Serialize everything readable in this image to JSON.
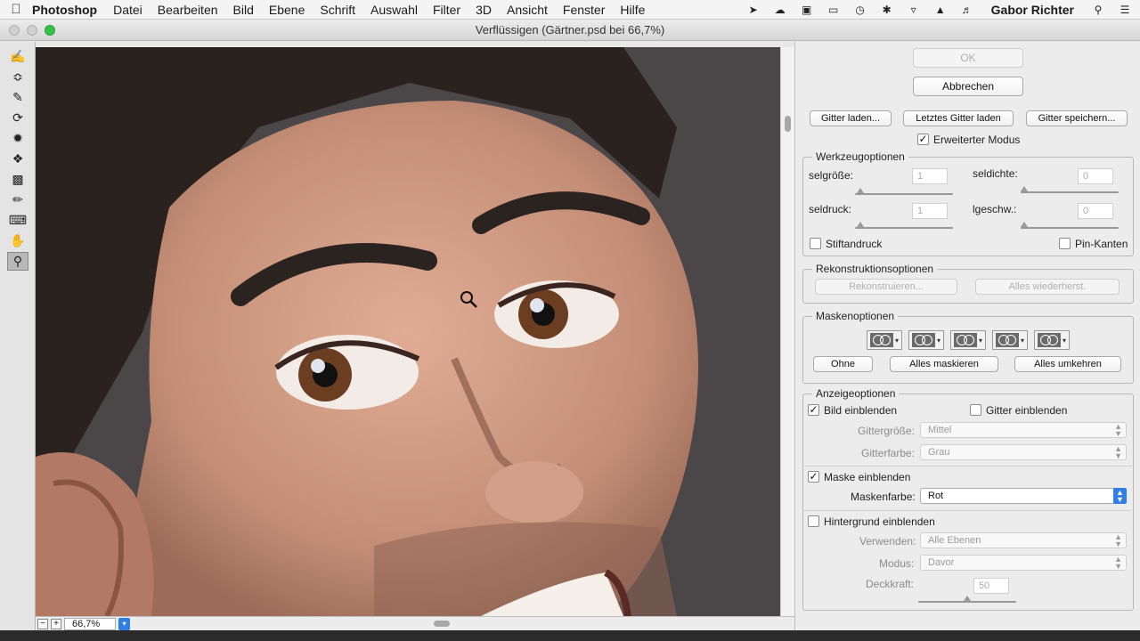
{
  "menubar": {
    "apple": "",
    "app": "Photoshop",
    "items": [
      "Datei",
      "Bearbeiten",
      "Bild",
      "Ebene",
      "Schrift",
      "Auswahl",
      "Filter",
      "3D",
      "Ansicht",
      "Fenster",
      "Hilfe"
    ],
    "user": "Gabor Richter",
    "tray_icons": [
      "forward-icon",
      "cloud-icon",
      "display-icon",
      "airplay-icon",
      "time-machine-icon",
      "bluetooth-icon",
      "wifi-icon",
      "eject-icon",
      "volume-icon",
      "search-icon",
      "list-icon"
    ]
  },
  "window": {
    "title": "Verflüssigen (Gärtner.psd bei 66,7%)"
  },
  "tools": [
    "forward-warp-icon",
    "reconstruct-icon",
    "smooth-icon",
    "twirl-icon",
    "pucker-icon",
    "bloat-icon",
    "push-left-icon",
    "freeze-mask-icon",
    "thaw-mask-icon",
    "hand-icon",
    "zoom-icon"
  ],
  "canvas": {
    "zoom": "66,7%"
  },
  "panel": {
    "ok": "OK",
    "cancel": "Abbrechen",
    "load_mesh": "Gitter laden...",
    "load_last_mesh": "Letztes Gitter laden",
    "save_mesh": "Gitter speichern...",
    "advanced_mode": "Erweiterter Modus",
    "tool_options": {
      "title": "Werkzeugoptionen",
      "brush_size_label": "selgröße:",
      "brush_size": "1",
      "brush_density_label": "seldichte:",
      "brush_density": "0",
      "brush_pressure_label": "seldruck:",
      "brush_pressure": "1",
      "brush_rate_label": "lgeschw.:",
      "brush_rate": "0",
      "stylus_pressure": "Stiftandruck",
      "pin_edges": "Pin-Kanten"
    },
    "reconstruct_options": {
      "title": "Rekonstruktionsoptionen",
      "reconstruct": "Rekonstruieren...",
      "restore_all": "Alles wiederherst."
    },
    "mask_options": {
      "title": "Maskenoptionen",
      "none": "Ohne",
      "mask_all": "Alles maskieren",
      "invert_all": "Alles umkehren"
    },
    "view_options": {
      "title": "Anzeigeoptionen",
      "show_image": "Bild einblenden",
      "show_mesh": "Gitter einblenden",
      "mesh_size_label": "Gittergröße:",
      "mesh_size": "Mittel",
      "mesh_color_label": "Gitterfarbe:",
      "mesh_color": "Grau",
      "show_mask": "Maske einblenden",
      "mask_color_label": "Maskenfarbe:",
      "mask_color": "Rot",
      "show_backdrop": "Hintergrund einblenden",
      "use_label": "Verwenden:",
      "use": "Alle Ebenen",
      "mode_label": "Modus:",
      "mode": "Davor",
      "opacity_label": "Deckkraft:",
      "opacity": "50"
    }
  },
  "colors": {
    "accent": "#2f7fe6",
    "skin": "#c99680",
    "background": "#4a4648"
  }
}
